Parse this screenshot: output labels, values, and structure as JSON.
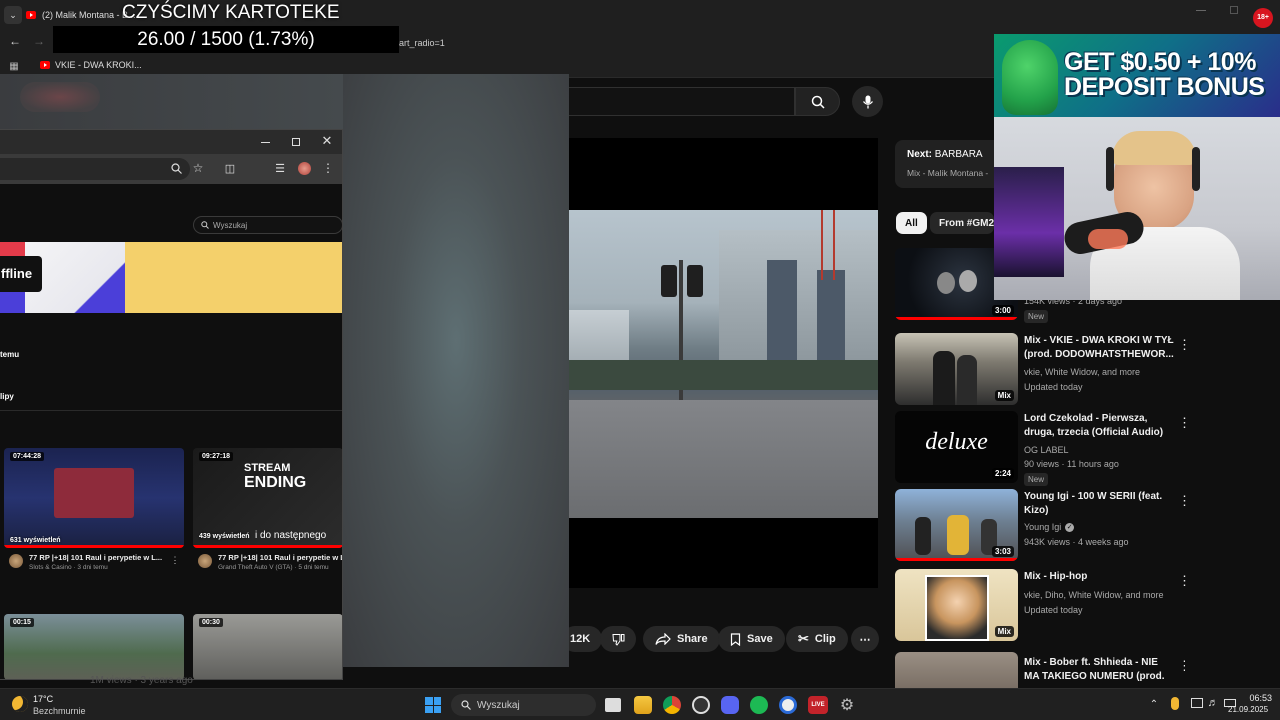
{
  "browser": {
    "active_tab_title": "(2) Malik Montana - B...",
    "url_fragment": "art_radio=1",
    "bookmark_label": "VKIE - DWA KROKI..."
  },
  "stream_overlay": {
    "title": "CZYŚCIMY KARTOTEKE",
    "goal": "26.00 / 1500 (1.73%)",
    "ad_line1": "GET $0.50 + 10%",
    "ad_line2": "DEPOSIT BONUS",
    "ad_badge": "18+"
  },
  "youtube": {
    "next_label": "Next:",
    "next_title": "BARBARA",
    "next_sub": "Mix - Malik Montana -",
    "chips": [
      "All",
      "From #GM2"
    ],
    "actions": {
      "likes": "12K",
      "share": "Share",
      "save": "Save",
      "clip": "Clip",
      "more": "⋯"
    },
    "recommendations": [
      {
        "title": "",
        "channel": "",
        "meta": "154K views · 2 days ago",
        "duration": "3:00",
        "badge": "New",
        "progress": 1.0
      },
      {
        "title": "Mix - VKIE - DWA KROKI W TYŁ (prod. DODOWHATSTHEWOR...",
        "channel": "vkie, White Widow, and more",
        "meta": "Updated today",
        "duration": "Mix",
        "badge": ""
      },
      {
        "title": "Lord Czekolad - Pierwsza, druga, trzecia (Official Audio)",
        "channel": "OG LABEL",
        "meta": "90 views · 11 hours ago",
        "duration": "2:24",
        "badge": "New",
        "thumb_text": "deluxe"
      },
      {
        "title": "Young Igi - 100 W SERII (feat. Kizo)",
        "channel": "Young Igi",
        "meta": "943K views · 4 weeks ago",
        "duration": "3:03",
        "badge": "",
        "progress": 1.0
      },
      {
        "title": "Mix - Hip-hop",
        "channel": "vkie, Diho, White Widow, and more",
        "meta": "Updated today",
        "duration": "Mix",
        "badge": ""
      },
      {
        "title": "Mix - Bober ft. Shhieda - NIE MA TAKIEGO NUMERU (prod. ...",
        "channel": "",
        "meta": "",
        "duration": "",
        "badge": ""
      }
    ]
  },
  "popup_window": {
    "search_placeholder": "Wyszukaj",
    "offline_label": "ffline",
    "section1": "temu",
    "section2": "lipy",
    "videos": [
      {
        "duration": "07:44:28",
        "views": "631 wyświetleń",
        "title": "77 RP |+18| 101 Raul i perypetie w L...",
        "sub": "Slots & Casino · 3 dni temu"
      },
      {
        "duration": "09:27:18",
        "views": "439 wyświetleń",
        "title": "77 RP |+18| 101 Raul i perypetie w L",
        "sub": "Grand Theft Auto V (GTA) · 5 dni temu",
        "overlay1": "STREAM",
        "overlay2": "ENDING",
        "overlay3": "i do następnego"
      },
      {
        "duration": "00:15"
      },
      {
        "duration": "00:30"
      }
    ],
    "under_text": "1M views · 3 years ago"
  },
  "taskbar": {
    "weather_temp": "17°C",
    "weather_desc": "Bezchmurnie",
    "search_label": "Wyszukaj",
    "time": "06:53",
    "date": "21.09.2025",
    "browser_badge": "LIVE"
  },
  "colors": {
    "yt_red": "#ff0000",
    "bg": "#0f0f0f",
    "chip_active": "#f1f1f1"
  }
}
